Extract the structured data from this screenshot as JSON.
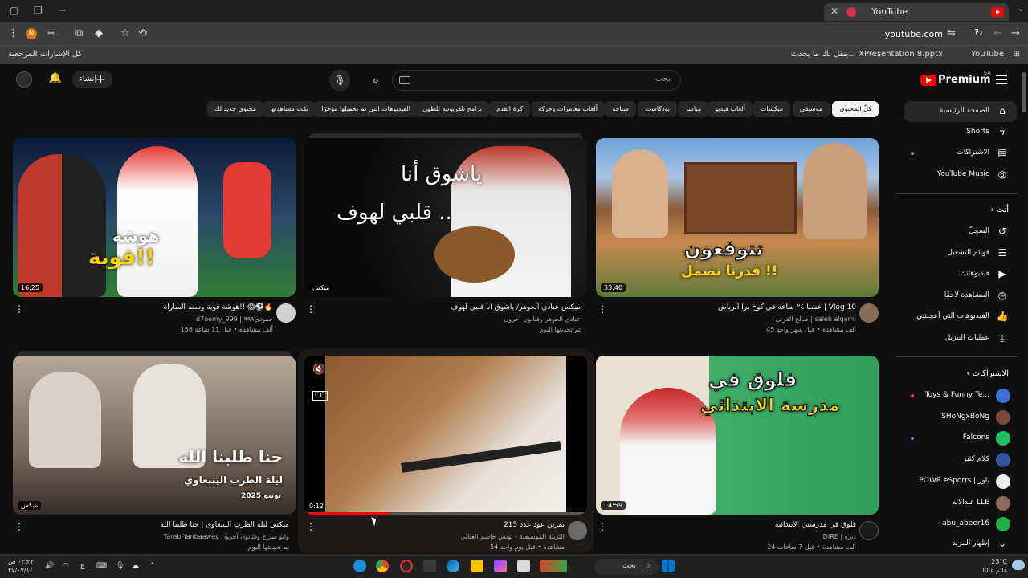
{
  "browser": {
    "tab_title": "YouTube",
    "url": "youtube.com",
    "profile_initial": "N",
    "bookmarks": [
      {
        "label": "YouTube"
      },
      {
        "label": "Presentation 8.pptx"
      },
      {
        "label": "ينقل لك ما يحدث... X"
      },
      {
        "label": "كل الإشارات المرجعية"
      }
    ]
  },
  "header": {
    "logo_text": "Premium",
    "region": "SA",
    "search_placeholder": "بحث",
    "create_label": "إنشاء"
  },
  "chips": [
    {
      "label": "كلّ المحتوى",
      "active": true
    },
    {
      "label": "موسيقى"
    },
    {
      "label": "ميكسات"
    },
    {
      "label": "ألعاب فيديو"
    },
    {
      "label": "مباشر"
    },
    {
      "label": "بودكاست"
    },
    {
      "label": "سباحة"
    },
    {
      "label": "ألعاب مغامرات وحركة"
    },
    {
      "label": "كرة القدم"
    },
    {
      "label": "برامج تلفزيونية للطهي"
    },
    {
      "label": "الفيديوهات التي تم تحميلها مؤخرًا"
    },
    {
      "label": "تمّت مشاهدتها"
    },
    {
      "label": "محتوى جديد لك"
    }
  ],
  "sidebar": {
    "main": [
      {
        "label": "الصفحة الرئيسية",
        "icon": "home-icon"
      },
      {
        "label": "Shorts",
        "icon": "shorts-icon"
      },
      {
        "label": "الاشتراكات",
        "icon": "subscriptions-icon"
      },
      {
        "label": "YouTube Music",
        "icon": "music-icon"
      }
    ],
    "you_header": "أنت",
    "you": [
      {
        "label": "السجلّ",
        "icon": "history-icon"
      },
      {
        "label": "قوائم التشغيل",
        "icon": "playlist-icon"
      },
      {
        "label": "فيديوهاتك",
        "icon": "your-videos-icon"
      },
      {
        "label": "المشاهدة لاحقًا",
        "icon": "clock-icon"
      },
      {
        "label": "الفيديوهات التي أعجبتني",
        "icon": "like-icon"
      },
      {
        "label": "عمليات التنزيل",
        "icon": "download-icon"
      }
    ],
    "subs_header": "الاشتراكات",
    "subs": [
      {
        "label": "Toys & Funny Te...",
        "color": "#3f6fd8"
      },
      {
        "label": "SHoNgxBoNg",
        "color": "#7a4a3a"
      },
      {
        "label": "Falcons",
        "color": "#20c060"
      },
      {
        "label": "كلام كثير",
        "color": "#3a50a0"
      },
      {
        "label": "POWR eSports | باور",
        "color": "#eeeeee"
      },
      {
        "label": "عبدالاله LLE",
        "color": "#8a6a5a"
      },
      {
        "label": "abu_abeer16",
        "color": "#1fae4b"
      }
    ],
    "show_more": "إظهار المزيد"
  },
  "videos": [
    {
      "title": "عشنا ٢٤ ساعة في كوخ برا الرياض | Vlog 10",
      "channel": "صالح القرني | saleh alqarni",
      "meta": "45 ألف مشاهدة • قبل شهر واحد",
      "duration": "33:40",
      "overlay": "تتوقعون",
      "overlay2": "قدرنا نصمل !!"
    },
    {
      "title": "ميكس عبادي الجوهر/ ياشوق أنا قلبي لهوف",
      "channel": "عبادي الجوهر وفنانون آخرون",
      "meta": "تم تحديثها اليوم",
      "duration": "ميكس",
      "overlay": "ياشوق أنا",
      "overlay2": "قلبي لهوف .."
    },
    {
      "title": "هوشة قوية وسط المباراة!! 😱⚽️🔥",
      "channel": "d7oomy_999 | حمودي٩٩٩",
      "meta": "156 ألف مشاهدة • قبل 11 ساعة",
      "duration": "16:25",
      "overlay": "هوشة",
      "overlay2": "قوية!!"
    },
    {
      "title": "فلوق في مدرستي الابتدائية",
      "channel": "DIRE | ديره",
      "meta": "24 ألف مشاهدة • قبل 7 ساعات",
      "duration": "14:59",
      "overlay": "فلوق في",
      "overlay2": "مدرسة الابتدائي"
    },
    {
      "title": "تمرين عود عدد 215",
      "channel": "التربية الموسيقية - تونس جاسم العنابي",
      "meta": "54 مشاهدة • قبل يوم واحد",
      "duration": "0:12",
      "progress": 0.3
    },
    {
      "title": "ميكس ليلة الطرب الينبعاوي | حنا طلبنا الله",
      "channel": "Tarab Yanbaawey وابو سراج وفنانون آخرون",
      "meta": "تم تحديثها اليوم",
      "duration": "ميكس",
      "overlay": "حنا طلبنا الله",
      "overlay2": "ليلة الطرب الينبعاوي",
      "overlay3": "يونيو 2025"
    }
  ],
  "taskbar": {
    "search_label": "بحث",
    "time": "٠٣:٢٣ ص",
    "date": "٢٧/٠٧/١٤",
    "weather_temp": "23°C",
    "weather_desc": "غائم غالبًا",
    "lang": "ع"
  }
}
